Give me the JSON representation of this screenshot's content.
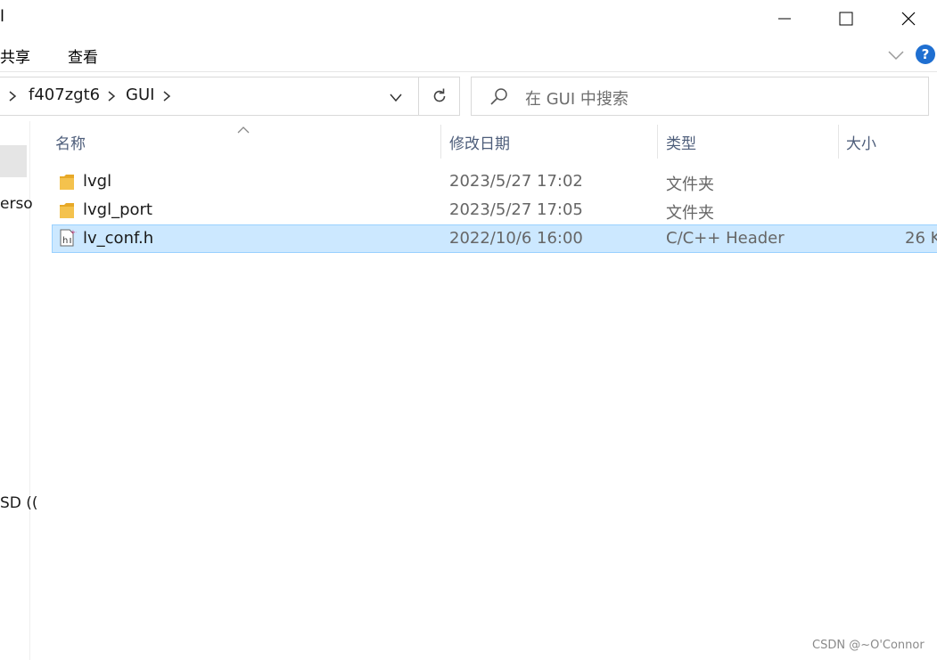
{
  "window": {
    "title_fragment": "l",
    "controls": [
      "minimize",
      "maximize",
      "close"
    ]
  },
  "ribbon": {
    "tabs": [
      "共享",
      "查看"
    ],
    "help_label": "?"
  },
  "address": {
    "crumbs": [
      "f407zgt6",
      "GUI"
    ]
  },
  "search": {
    "placeholder": "在 GUI 中搜索"
  },
  "nav": {
    "items": [
      "erso",
      "SD (("
    ]
  },
  "columns": {
    "name": "名称",
    "date": "修改日期",
    "type": "类型",
    "size": "大小"
  },
  "files": [
    {
      "name": "lvgl",
      "date": "2023/5/27 17:02",
      "type": "文件夹",
      "size": "",
      "icon": "folder-icon",
      "selected": false
    },
    {
      "name": "lvgl_port",
      "date": "2023/5/27 17:05",
      "type": "文件夹",
      "size": "",
      "icon": "folder-icon",
      "selected": false
    },
    {
      "name": "lv_conf.h",
      "date": "2022/10/6 16:00",
      "type": "C/C++ Header",
      "size": "26 K",
      "icon": "header-file-icon",
      "selected": true
    }
  ],
  "watermark": "CSDN @~O'Connor",
  "colors": {
    "selection_bg": "#cce8ff",
    "selection_border": "#99d1ff",
    "folder": "#f4c24d",
    "help_blue": "#1f6fd1",
    "header_text": "#4d5d7a"
  }
}
